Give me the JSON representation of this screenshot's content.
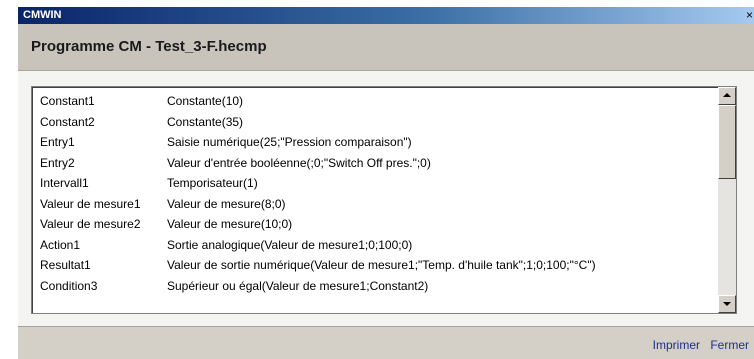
{
  "window": {
    "title": "CMWIN",
    "close_glyph": "×"
  },
  "program": {
    "title": "Programme CM - Test_3-F.hecmp"
  },
  "list": {
    "rows": [
      {
        "name": "Constant1",
        "value": "Constante(10)"
      },
      {
        "name": "Constant2",
        "value": "Constante(35)"
      },
      {
        "name": "Entry1",
        "value": "Saisie numérique(25;\"Pression comparaison\")"
      },
      {
        "name": "Entry2",
        "value": "Valeur d'entrée booléenne(;0;\"Switch Off pres.\";0)"
      },
      {
        "name": "Intervall1",
        "value": "Temporisateur(1)"
      },
      {
        "name": "Valeur de mesure1",
        "value": "Valeur de mesure(8;0)"
      },
      {
        "name": "Valeur de mesure2",
        "value": "Valeur de mesure(10;0)"
      },
      {
        "name": "Action1",
        "value": "Sortie analogique(Valeur de mesure1;0;100;0)"
      },
      {
        "name": "Resultat1",
        "value": "Valeur de sortie numérique(Valeur de mesure1;\"Temp. d'huile tank\";1;0;100;\"°C\")"
      },
      {
        "name": "Condition3",
        "value": "Supérieur ou égal(Valeur de mesure1;Constant2)"
      }
    ]
  },
  "footer": {
    "print_label": "Imprimer",
    "close_label": "Fermer"
  },
  "colors": {
    "titlebar_start": "#0a246a",
    "titlebar_end": "#a6caf0",
    "link": "#1b2f8f",
    "panel": "#d4d0c8"
  }
}
